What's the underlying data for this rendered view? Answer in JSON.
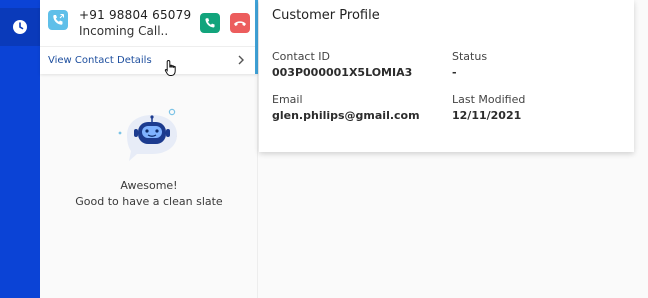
{
  "rail": {
    "active_icon": "clock-icon",
    "color": "#0b43d6"
  },
  "call": {
    "phone_number": "+91 98804 65079",
    "status": "Incoming Call..",
    "view_details": "View Contact Details",
    "accept_color": "#12a47c",
    "decline_color": "#ec5d5d"
  },
  "empty_state": {
    "line1": "Awesome!",
    "line2": "Good to have a clean slate"
  },
  "profile": {
    "title": "Customer Profile",
    "contact_id_label": "Contact ID",
    "contact_id_value": "003P000001X5LOMIA3",
    "status_label": "Status",
    "status_value": "-",
    "email_label": "Email",
    "email_value": "glen.philips@gmail.com",
    "last_modified_label": "Last Modified",
    "last_modified_value": "12/11/2021"
  }
}
